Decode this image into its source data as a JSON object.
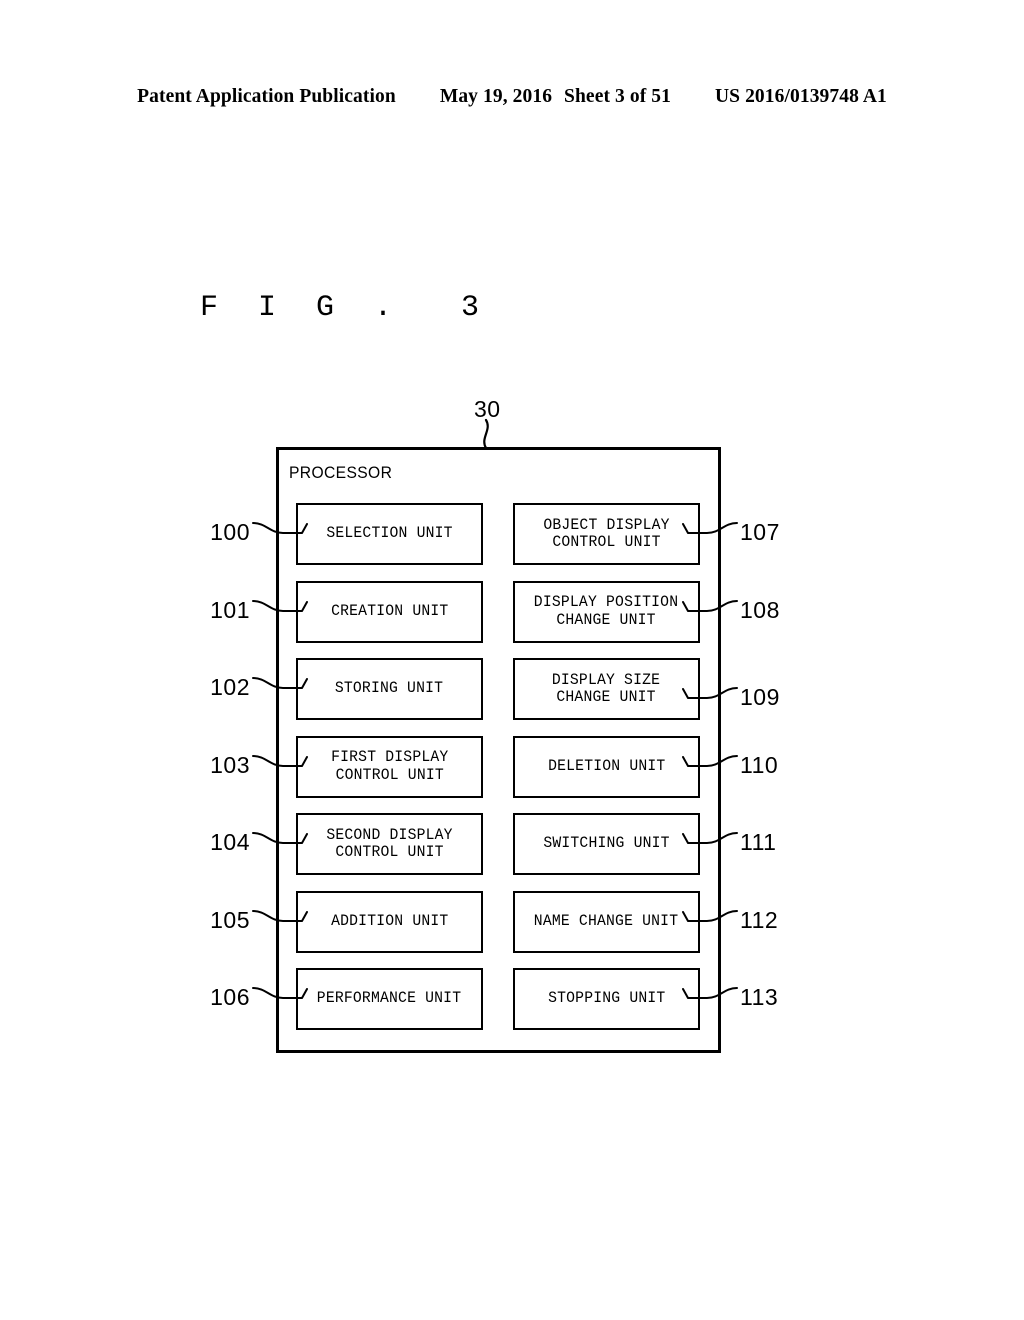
{
  "page_header": {
    "publication": "Patent Application Publication",
    "date": "May 19, 2016",
    "sheet": "Sheet 3 of 51",
    "publication_number": "US 2016/0139748 A1"
  },
  "figure": {
    "title": "F I G .  3",
    "enclosure": {
      "reference": "30",
      "label": "PROCESSOR"
    },
    "left_column": [
      {
        "reference": "100",
        "label": "SELECTION UNIT"
      },
      {
        "reference": "101",
        "label": "CREATION UNIT"
      },
      {
        "reference": "102",
        "label": "STORING UNIT"
      },
      {
        "reference": "103",
        "label": "FIRST DISPLAY\nCONTROL UNIT"
      },
      {
        "reference": "104",
        "label": "SECOND DISPLAY\nCONTROL UNIT"
      },
      {
        "reference": "105",
        "label": "ADDITION UNIT"
      },
      {
        "reference": "106",
        "label": "PERFORMANCE UNIT"
      }
    ],
    "right_column": [
      {
        "reference": "107",
        "label": "OBJECT DISPLAY\nCONTROL UNIT"
      },
      {
        "reference": "108",
        "label": "DISPLAY POSITION\nCHANGE UNIT"
      },
      {
        "reference": "109",
        "label": "DISPLAY SIZE\nCHANGE UNIT"
      },
      {
        "reference": "110",
        "label": "DELETION UNIT"
      },
      {
        "reference": "111",
        "label": "SWITCHING UNIT"
      },
      {
        "reference": "112",
        "label": "NAME CHANGE UNIT"
      },
      {
        "reference": "113",
        "label": "STOPPING UNIT"
      }
    ]
  },
  "colors": {
    "ink": "#000000",
    "paper": "#ffffff"
  }
}
